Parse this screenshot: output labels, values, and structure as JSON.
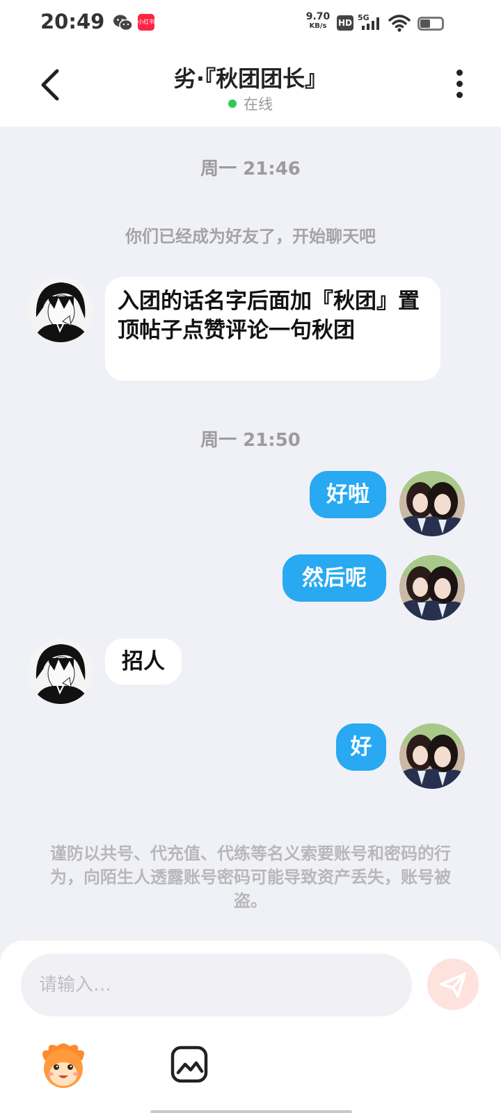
{
  "status_bar": {
    "time": "20:49",
    "xhs_label": "小红书",
    "net_speed_value": "9.70",
    "net_speed_unit": "KB/s",
    "hd": "HD",
    "signal_type": "5G"
  },
  "header": {
    "title": "劣·『秋团团长』",
    "presence": "在线"
  },
  "chat": {
    "sep1": "周一 21:46",
    "system_msg": "你们已经成为好友了，开始聊天吧",
    "msg1": " 入团的话名字后面加『秋团』置顶帖子点赞评论一句秋团",
    "sep2": "周一 21:50",
    "msg2": "好啦",
    "msg3": "然后呢",
    "msg4": "招人",
    "msg5": "好",
    "warning": "谨防以共号、代充值、代练等名义索要账号和密码的行为，向陌生人透露账号密码可能导致资产丢失，账号被盗。"
  },
  "input": {
    "placeholder": "请输入…"
  },
  "colors": {
    "outgoing_bubble": "#28a9f2",
    "incoming_bubble": "#ffffff",
    "online_dot": "#33c759",
    "send_button": "#fde2dd",
    "background": "#f0f1f6"
  },
  "icons": [
    "wechat-icon",
    "xiaohongshu-icon",
    "hd-icon",
    "signal-icon",
    "wifi-icon",
    "battery-icon",
    "back-arrow-icon",
    "more-vertical-icon",
    "send-icon",
    "emoji-icon",
    "image-icon"
  ]
}
